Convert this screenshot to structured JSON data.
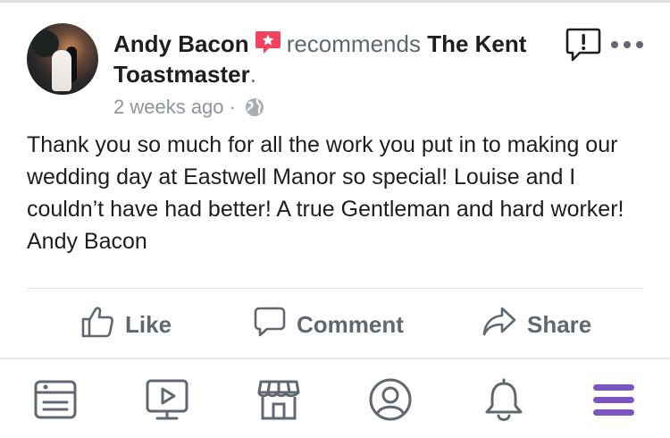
{
  "post": {
    "author": "Andy Bacon",
    "verb": "recommends",
    "page_name": "The Kent Toastmaster",
    "period": ".",
    "timestamp": "2 weeks ago",
    "separator": "·",
    "privacy_icon": "globe-icon",
    "body": "Thank you so much for all the work you put in to making our wedding day at Eastwell Manor so special! Louise and I couldn’t have had better! A true Gentleman and hard worker! Andy Bacon"
  },
  "actions": {
    "like_label": "Like",
    "comment_label": "Comment",
    "share_label": "Share"
  },
  "bottom_nav": {
    "items": [
      "news-feed-icon",
      "watch-icon",
      "marketplace-icon",
      "profile-icon",
      "notifications-icon",
      "menu-icon"
    ],
    "active": "menu-icon"
  },
  "colors": {
    "text_primary": "#1c1e21",
    "text_secondary": "#606770",
    "meta": "#8d949e",
    "icon": "#606770",
    "recommend_badge": "#f3425f",
    "active_nav": "#7b56c2",
    "divider": "#dadde1"
  }
}
